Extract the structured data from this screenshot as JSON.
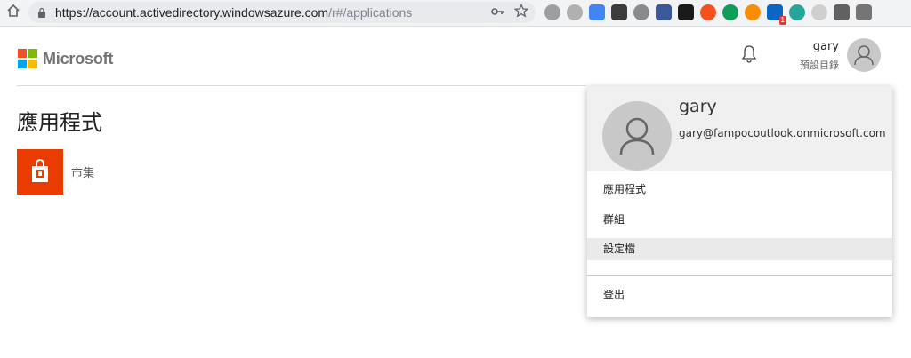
{
  "browser": {
    "url_host": "https://account.activedirectory.windowsazure.com",
    "url_path": "/r#/applications",
    "extensions": [
      {
        "name": "grey-circle-ext-icon",
        "color": "#9e9e9e",
        "round": true
      },
      {
        "name": "cloud-ext-icon",
        "color": "#b0b0b0",
        "round": true
      },
      {
        "name": "translate-ext-icon",
        "color": "#4285f4",
        "round": false
      },
      {
        "name": "shield-ext-icon",
        "color": "#3c3c3c",
        "round": false
      },
      {
        "name": "target-ext-icon",
        "color": "#8a8a8a",
        "round": true
      },
      {
        "name": "flag-ext-icon",
        "color": "#3b5998",
        "round": false
      },
      {
        "name": "cursor-ext-icon",
        "color": "#1a1a1a",
        "round": false
      },
      {
        "name": "wave-ext-icon",
        "color": "#f4511e",
        "round": true
      },
      {
        "name": "chat-ext-icon",
        "color": "#0f9d58",
        "round": true
      },
      {
        "name": "play-ext-icon",
        "color": "#fb8c00",
        "round": true
      },
      {
        "name": "linkedin-ext-icon",
        "color": "#0a66c2",
        "round": false,
        "badge": "1"
      },
      {
        "name": "teal-circle-ext-icon",
        "color": "#26a69a",
        "round": true
      },
      {
        "name": "light-circle-ext-icon",
        "color": "#cfcfcf",
        "round": true
      },
      {
        "name": "folder-ext-icon",
        "color": "#616161",
        "round": false
      },
      {
        "name": "camera-ext-icon",
        "color": "#757575",
        "round": false
      }
    ]
  },
  "header": {
    "brand": "Microsoft",
    "user_name": "gary",
    "user_directory": "預設目錄"
  },
  "main": {
    "title": "應用程式",
    "apps": [
      {
        "label": "市集",
        "tile_color": "#eb3c00"
      }
    ]
  },
  "dropdown": {
    "name": "gary",
    "email": "gary@fampocoutlook.onmicrosoft.com",
    "items": [
      {
        "label": "應用程式"
      },
      {
        "label": "群組"
      },
      {
        "label": "設定檔"
      }
    ],
    "signout": "登出"
  }
}
